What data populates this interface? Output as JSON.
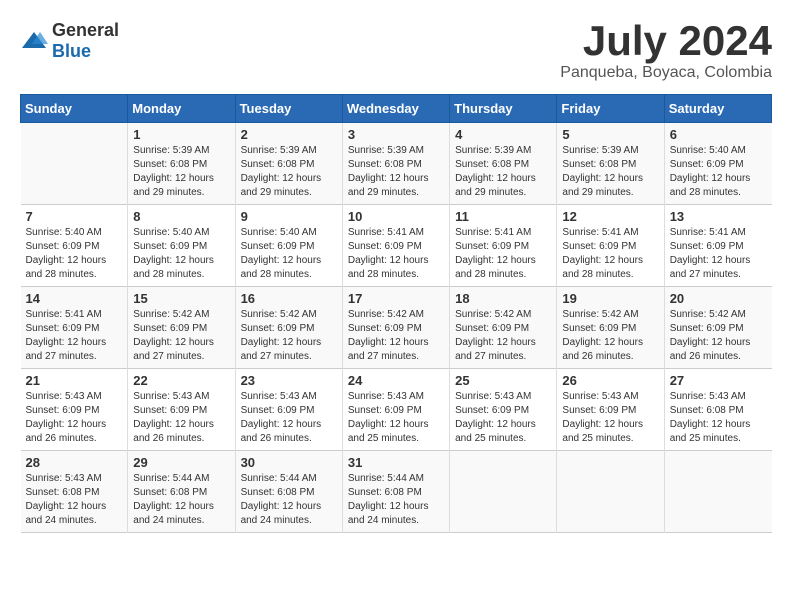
{
  "header": {
    "logo_general": "General",
    "logo_blue": "Blue",
    "month_title": "July 2024",
    "location": "Panqueba, Boyaca, Colombia"
  },
  "weekdays": [
    "Sunday",
    "Monday",
    "Tuesday",
    "Wednesday",
    "Thursday",
    "Friday",
    "Saturday"
  ],
  "weeks": [
    [
      {
        "day": "",
        "info": ""
      },
      {
        "day": "1",
        "info": "Sunrise: 5:39 AM\nSunset: 6:08 PM\nDaylight: 12 hours\nand 29 minutes."
      },
      {
        "day": "2",
        "info": "Sunrise: 5:39 AM\nSunset: 6:08 PM\nDaylight: 12 hours\nand 29 minutes."
      },
      {
        "day": "3",
        "info": "Sunrise: 5:39 AM\nSunset: 6:08 PM\nDaylight: 12 hours\nand 29 minutes."
      },
      {
        "day": "4",
        "info": "Sunrise: 5:39 AM\nSunset: 6:08 PM\nDaylight: 12 hours\nand 29 minutes."
      },
      {
        "day": "5",
        "info": "Sunrise: 5:39 AM\nSunset: 6:08 PM\nDaylight: 12 hours\nand 29 minutes."
      },
      {
        "day": "6",
        "info": "Sunrise: 5:40 AM\nSunset: 6:09 PM\nDaylight: 12 hours\nand 28 minutes."
      }
    ],
    [
      {
        "day": "7",
        "info": "Sunrise: 5:40 AM\nSunset: 6:09 PM\nDaylight: 12 hours\nand 28 minutes."
      },
      {
        "day": "8",
        "info": "Sunrise: 5:40 AM\nSunset: 6:09 PM\nDaylight: 12 hours\nand 28 minutes."
      },
      {
        "day": "9",
        "info": "Sunrise: 5:40 AM\nSunset: 6:09 PM\nDaylight: 12 hours\nand 28 minutes."
      },
      {
        "day": "10",
        "info": "Sunrise: 5:41 AM\nSunset: 6:09 PM\nDaylight: 12 hours\nand 28 minutes."
      },
      {
        "day": "11",
        "info": "Sunrise: 5:41 AM\nSunset: 6:09 PM\nDaylight: 12 hours\nand 28 minutes."
      },
      {
        "day": "12",
        "info": "Sunrise: 5:41 AM\nSunset: 6:09 PM\nDaylight: 12 hours\nand 28 minutes."
      },
      {
        "day": "13",
        "info": "Sunrise: 5:41 AM\nSunset: 6:09 PM\nDaylight: 12 hours\nand 27 minutes."
      }
    ],
    [
      {
        "day": "14",
        "info": "Sunrise: 5:41 AM\nSunset: 6:09 PM\nDaylight: 12 hours\nand 27 minutes."
      },
      {
        "day": "15",
        "info": "Sunrise: 5:42 AM\nSunset: 6:09 PM\nDaylight: 12 hours\nand 27 minutes."
      },
      {
        "day": "16",
        "info": "Sunrise: 5:42 AM\nSunset: 6:09 PM\nDaylight: 12 hours\nand 27 minutes."
      },
      {
        "day": "17",
        "info": "Sunrise: 5:42 AM\nSunset: 6:09 PM\nDaylight: 12 hours\nand 27 minutes."
      },
      {
        "day": "18",
        "info": "Sunrise: 5:42 AM\nSunset: 6:09 PM\nDaylight: 12 hours\nand 27 minutes."
      },
      {
        "day": "19",
        "info": "Sunrise: 5:42 AM\nSunset: 6:09 PM\nDaylight: 12 hours\nand 26 minutes."
      },
      {
        "day": "20",
        "info": "Sunrise: 5:42 AM\nSunset: 6:09 PM\nDaylight: 12 hours\nand 26 minutes."
      }
    ],
    [
      {
        "day": "21",
        "info": "Sunrise: 5:43 AM\nSunset: 6:09 PM\nDaylight: 12 hours\nand 26 minutes."
      },
      {
        "day": "22",
        "info": "Sunrise: 5:43 AM\nSunset: 6:09 PM\nDaylight: 12 hours\nand 26 minutes."
      },
      {
        "day": "23",
        "info": "Sunrise: 5:43 AM\nSunset: 6:09 PM\nDaylight: 12 hours\nand 26 minutes."
      },
      {
        "day": "24",
        "info": "Sunrise: 5:43 AM\nSunset: 6:09 PM\nDaylight: 12 hours\nand 25 minutes."
      },
      {
        "day": "25",
        "info": "Sunrise: 5:43 AM\nSunset: 6:09 PM\nDaylight: 12 hours\nand 25 minutes."
      },
      {
        "day": "26",
        "info": "Sunrise: 5:43 AM\nSunset: 6:09 PM\nDaylight: 12 hours\nand 25 minutes."
      },
      {
        "day": "27",
        "info": "Sunrise: 5:43 AM\nSunset: 6:08 PM\nDaylight: 12 hours\nand 25 minutes."
      }
    ],
    [
      {
        "day": "28",
        "info": "Sunrise: 5:43 AM\nSunset: 6:08 PM\nDaylight: 12 hours\nand 24 minutes."
      },
      {
        "day": "29",
        "info": "Sunrise: 5:44 AM\nSunset: 6:08 PM\nDaylight: 12 hours\nand 24 minutes."
      },
      {
        "day": "30",
        "info": "Sunrise: 5:44 AM\nSunset: 6:08 PM\nDaylight: 12 hours\nand 24 minutes."
      },
      {
        "day": "31",
        "info": "Sunrise: 5:44 AM\nSunset: 6:08 PM\nDaylight: 12 hours\nand 24 minutes."
      },
      {
        "day": "",
        "info": ""
      },
      {
        "day": "",
        "info": ""
      },
      {
        "day": "",
        "info": ""
      }
    ]
  ]
}
